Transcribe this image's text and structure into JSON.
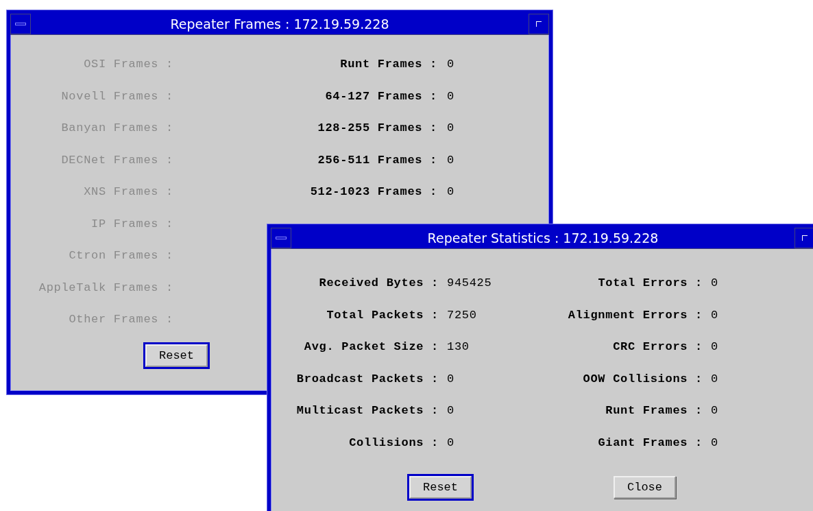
{
  "windows": [
    {
      "title": "Repeater Frames : 172.19.59.228",
      "protocol_frames": [
        {
          "label": "OSI Frames :",
          "disabled": true
        },
        {
          "label": "Novell Frames :",
          "disabled": true
        },
        {
          "label": "Banyan Frames :",
          "disabled": true
        },
        {
          "label": "DECNet Frames :",
          "disabled": true
        },
        {
          "label": "XNS Frames :",
          "disabled": true
        },
        {
          "label": "IP Frames :",
          "disabled": true
        },
        {
          "label": "Ctron Frames :",
          "disabled": true
        },
        {
          "label": "AppleTalk Frames :",
          "disabled": true
        },
        {
          "label": "Other Frames :",
          "disabled": true
        }
      ],
      "size_frames": [
        {
          "label": "Runt Frames :",
          "value": "0"
        },
        {
          "label": "64-127 Frames :",
          "value": "0"
        },
        {
          "label": "128-255 Frames :",
          "value": "0"
        },
        {
          "label": "256-511 Frames :",
          "value": "0"
        },
        {
          "label": "512-1023 Frames :",
          "value": "0"
        }
      ],
      "buttons": [
        {
          "label": "Reset",
          "focused": true
        }
      ]
    },
    {
      "title": "Repeater Statistics : 172.19.59.228",
      "traffic": [
        {
          "label": "Received Bytes :",
          "value": "945425"
        },
        {
          "label": "Total Packets :",
          "value": "7250"
        },
        {
          "label": "Avg. Packet Size :",
          "value": "130"
        },
        {
          "label": "Broadcast Packets :",
          "value": "0"
        },
        {
          "label": "Multicast Packets :",
          "value": "0"
        },
        {
          "label": "Collisions :",
          "value": "0"
        }
      ],
      "errors": [
        {
          "label": "Total Errors :",
          "value": "0"
        },
        {
          "label": "Alignment Errors :",
          "value": "0"
        },
        {
          "label": "CRC Errors :",
          "value": "0"
        },
        {
          "label": "OOW Collisions :",
          "value": "0"
        },
        {
          "label": "Runt Frames :",
          "value": "0"
        },
        {
          "label": "Giant Frames :",
          "value": "0"
        }
      ],
      "buttons": [
        {
          "label": "Reset",
          "focused": true
        },
        {
          "label": "Close",
          "focused": false
        }
      ]
    }
  ]
}
